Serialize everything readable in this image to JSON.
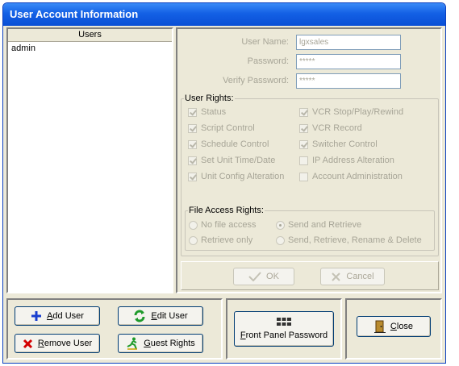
{
  "window": {
    "title": "User Account Information"
  },
  "users": {
    "header": "Users",
    "items": [
      "admin"
    ]
  },
  "account": {
    "username_label": "User Name:",
    "username_value": "lgxsales",
    "password_label": "Password:",
    "password_value": "*****",
    "verify_label": "Verify Password:",
    "verify_value": "*****"
  },
  "user_rights": {
    "title": "User Rights:",
    "left": [
      {
        "label": "Status",
        "checked": true
      },
      {
        "label": "Script Control",
        "checked": true
      },
      {
        "label": "Schedule Control",
        "checked": true
      },
      {
        "label": "Set Unit Time/Date",
        "checked": true
      },
      {
        "label": "Unit Config Alteration",
        "checked": true
      }
    ],
    "right": [
      {
        "label": "VCR Stop/Play/Rewind",
        "checked": true
      },
      {
        "label": "VCR Record",
        "checked": true
      },
      {
        "label": "Switcher Control",
        "checked": true
      },
      {
        "label": "IP Address Alteration",
        "checked": false
      },
      {
        "label": "Account Administration",
        "checked": false
      }
    ]
  },
  "file_access": {
    "title": "File Access Rights:",
    "options": [
      {
        "label": "No file access",
        "selected": false
      },
      {
        "label": "Send and Retrieve",
        "selected": true
      },
      {
        "label": "Retrieve only",
        "selected": false
      },
      {
        "label": "Send, Retrieve, Rename & Delete",
        "selected": false
      }
    ]
  },
  "actions": {
    "ok": "OK",
    "cancel": "Cancel"
  },
  "bottom": {
    "add_user_hot": "A",
    "add_user_rest": "dd User",
    "edit_user_hot": "E",
    "edit_user_rest": "dit User",
    "remove_user_hot": "R",
    "remove_user_rest": "emove User",
    "guest_rights_hot": "G",
    "guest_rights_rest": "uest Rights",
    "front_panel_hot": "F",
    "front_panel_rest": "ront Panel Password",
    "close_hot": "C",
    "close_rest": "lose"
  },
  "colors": {
    "title_bar": "#1360e5",
    "add_icon": "#1a3fcf",
    "edit_icon": "#1e9a2a",
    "remove_icon": "#d40000",
    "guest_icon": "#1e9a2a"
  }
}
